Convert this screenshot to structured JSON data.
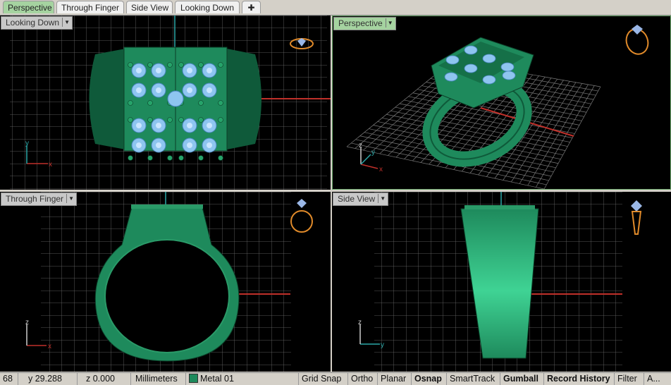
{
  "tabs": [
    {
      "label": "Perspective",
      "active": true
    },
    {
      "label": "Through Finger",
      "active": false
    },
    {
      "label": "Side View",
      "active": false
    },
    {
      "label": "Looking Down",
      "active": false
    }
  ],
  "add_tab_icon": "plus-icon",
  "viewports": {
    "top_left": {
      "label": "Looking Down",
      "active": false
    },
    "top_right": {
      "label": "Perspective",
      "active": true
    },
    "bottom_left": {
      "label": "Through Finger",
      "active": false
    },
    "bottom_right": {
      "label": "Side View",
      "active": false
    }
  },
  "axes": {
    "x": "x",
    "y": "y",
    "z": "z"
  },
  "status": {
    "x_coord": "68",
    "y_coord": "y 29.288",
    "z_coord": "z 0.000",
    "units": "Millimeters",
    "layer": "Metal 01",
    "grid_snap": "Grid Snap",
    "ortho": "Ortho",
    "planar": "Planar",
    "osnap": "Osnap",
    "smarttrack": "SmartTrack",
    "gumball": "Gumball",
    "record_history": "Record History",
    "filter": "Filter",
    "more": "A..."
  },
  "colors": {
    "metal": "#1e8a5c",
    "gem": "#8ec5f0",
    "active_tab": "#a5d3a0",
    "x_axis": "#c0302a",
    "y_axis": "#2aa7a7"
  }
}
